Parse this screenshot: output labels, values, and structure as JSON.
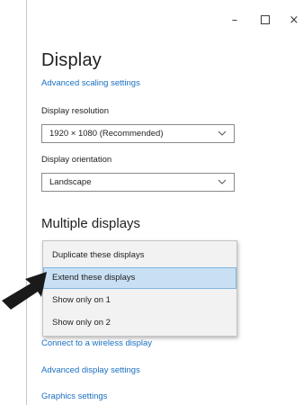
{
  "window": {
    "controls": {
      "minimize": "–",
      "close": "×"
    }
  },
  "display": {
    "title": "Display",
    "advanced_scaling_link": "Advanced scaling settings",
    "resolution": {
      "label": "Display resolution",
      "value": "1920 × 1080 (Recommended)"
    },
    "orientation": {
      "label": "Display orientation",
      "value": "Landscape"
    }
  },
  "multiple_displays": {
    "title": "Multiple displays",
    "menu_items": [
      {
        "label": "Duplicate these displays",
        "selected": false
      },
      {
        "label": "Extend these displays",
        "selected": true
      },
      {
        "label": "Show only on 1",
        "selected": false
      },
      {
        "label": "Show only on 2",
        "selected": false
      }
    ]
  },
  "links": {
    "wireless": "Connect to a wireless display",
    "advanced_display": "Advanced display settings",
    "graphics": "Graphics settings"
  },
  "colors": {
    "link": "#1a6fc2",
    "selected_item_bg": "#c9e0f4",
    "selected_item_border": "#7fb4e0",
    "menu_bg": "#f2f2f2",
    "arrow": "#1a1a1a"
  },
  "icons": {
    "minimize": "minimize-icon",
    "maximize": "maximize-icon",
    "close": "close-icon",
    "dropdown": "chevron-down-icon",
    "pointer": "pointer-arrow-icon"
  }
}
